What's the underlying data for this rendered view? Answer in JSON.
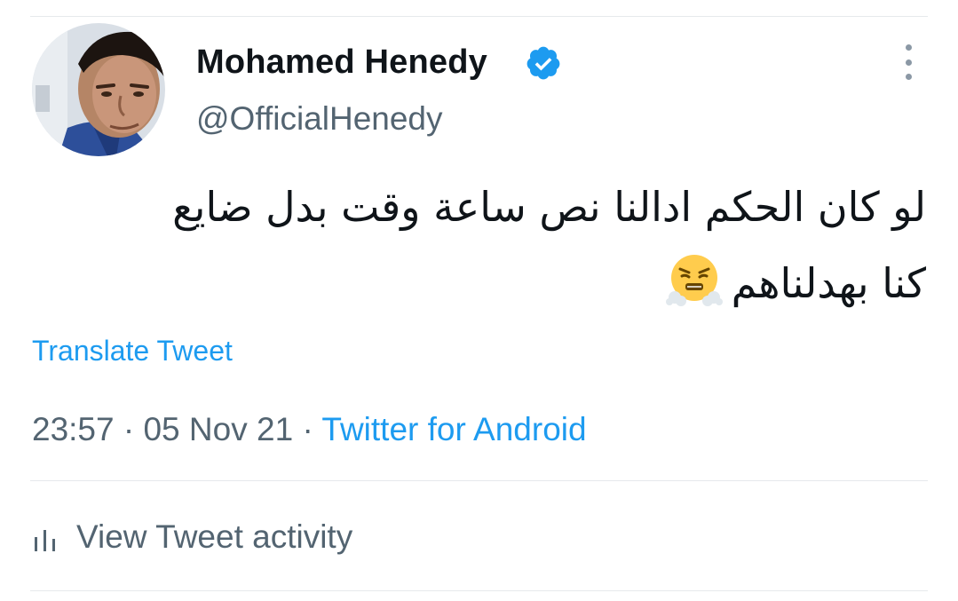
{
  "tweet": {
    "author": {
      "name": "Mohamed Henedy",
      "handle": "@OfficialHenedy",
      "verified": true,
      "avatar_icon": "profile-photo"
    },
    "text_lines": [
      "لو كان الحكم ادالنا نص ساعة وقت بدل ضايع",
      "كنا بهدلناهم"
    ],
    "emoji": "face-with-steam-from-nose",
    "translate_label": "Translate Tweet",
    "time": "23:57",
    "separator": "·",
    "date": "05 Nov 21",
    "source": "Twitter for Android",
    "activity_label": "View Tweet activity",
    "more_icon": "more-vertical-icon"
  },
  "colors": {
    "accent": "#1d9bf0",
    "secondary_text": "#536471",
    "primary_text": "#0f1419",
    "divider": "#e6e9ec"
  }
}
